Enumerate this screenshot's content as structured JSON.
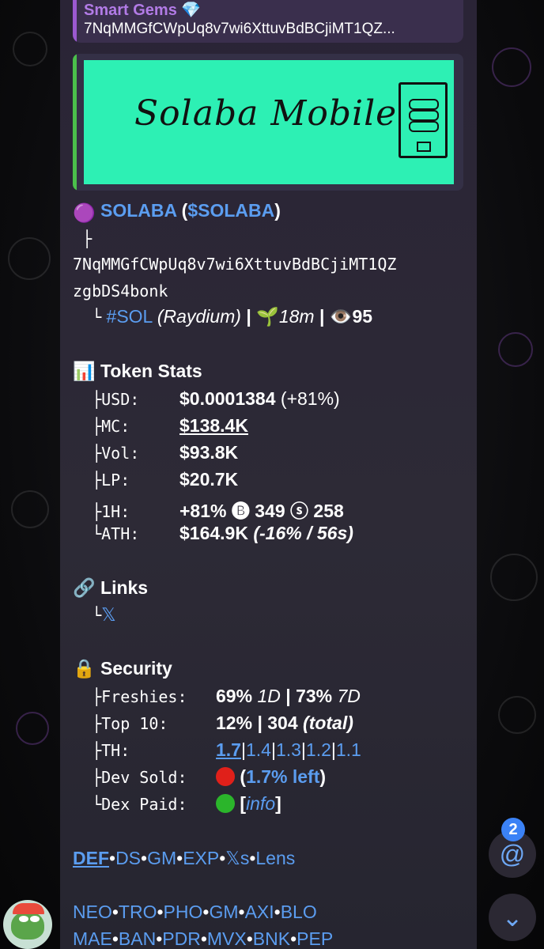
{
  "reply": {
    "title": "Smart Gems 💎",
    "address": "7NqMMGfCWpUq8v7wi6XttuvBdBCjiMT1QZ..."
  },
  "media": {
    "handwriting": "Solaba Mobile"
  },
  "token": {
    "emoji": "🟣",
    "name": "SOLABA",
    "ticker_open": " (",
    "ticker": "$SOLABA",
    "ticker_close": ")",
    "tree_top": "├",
    "address_line1": "7NqMMGfCWpUq8v7wi6XttuvBdBCjiMT1QZ",
    "address_line2": "zgbDS4bonk",
    "tree_end": "└",
    "chain": "#SOL",
    "dex": "(Raydium)",
    "sep": "|",
    "age_emoji": "🌱",
    "age": "18m",
    "views_emoji": "👁️",
    "views": "95"
  },
  "stats": {
    "header_emoji": "📊",
    "header": "Token Stats",
    "rows": [
      {
        "prefix": "├",
        "label": "USD:",
        "value": "$0.0001384",
        "extra": "(+81%)"
      },
      {
        "prefix": "├",
        "label": "MC:",
        "value": "$138.4K",
        "extra": ""
      },
      {
        "prefix": "├",
        "label": "Vol:",
        "value": "$93.8K",
        "extra": ""
      },
      {
        "prefix": "├",
        "label": "LP:",
        "value": "$20.7K",
        "extra": ""
      },
      {
        "prefix": "├",
        "label": "1H:",
        "value": "+81%",
        "extra": "🅑 349 ⓢ 258"
      },
      {
        "prefix": "└",
        "label": "ATH:",
        "value": "$164.9K",
        "extra": "(-16% / 56s)"
      }
    ]
  },
  "links": {
    "header_emoji": "🔗",
    "header": "Links",
    "prefix": "└",
    "x_label": "𝕏"
  },
  "security": {
    "header_emoji": "🔒",
    "header": "Security",
    "freshies_prefix": "├",
    "freshies_label": "Freshies:",
    "freshies_1d": "69%",
    "freshies_1d_tag": "1D",
    "freshies_sep": "|",
    "freshies_7d": "73%",
    "freshies_7d_tag": "7D",
    "top10_prefix": "├",
    "top10_label": "Top 10:",
    "top10_value": "12%",
    "top10_sep": "|",
    "top10_count": "304",
    "top10_total": "(total)",
    "th_prefix": "├",
    "th_label": "TH:",
    "th_values": [
      "1.7",
      "1.4",
      "1.3",
      "1.2",
      "1.1"
    ],
    "dev_prefix": "├",
    "dev_label": "Dev Sold:",
    "dev_open": "(",
    "dev_left": "1.7% left",
    "dev_close": ")",
    "dex_prefix": "└",
    "dex_label": "Dex Paid:",
    "dex_open": "[",
    "dex_info": "info",
    "dex_close": "]"
  },
  "links_row1": [
    "DEF",
    "DS",
    "GM",
    "EXP",
    "𝕏s",
    "Lens"
  ],
  "links_row2": [
    "NEO",
    "TRO",
    "PHO",
    "GM",
    "AXI",
    "BLO"
  ],
  "links_row3": [
    "MAE",
    "BAN",
    "PDR",
    "MVX",
    "BNK",
    "PEP"
  ],
  "dot": "•",
  "mentions_badge": "2",
  "mention_symbol": "@",
  "scroll_symbol": "⌄",
  "colors": {
    "accent_blue": "#5b9df0",
    "reply_purple": "#b27be6",
    "media_bar": "#4bbf4b",
    "media_bg": "#2df0b4",
    "red_dot": "#e0201a",
    "green_dot": "#2bb52b"
  }
}
